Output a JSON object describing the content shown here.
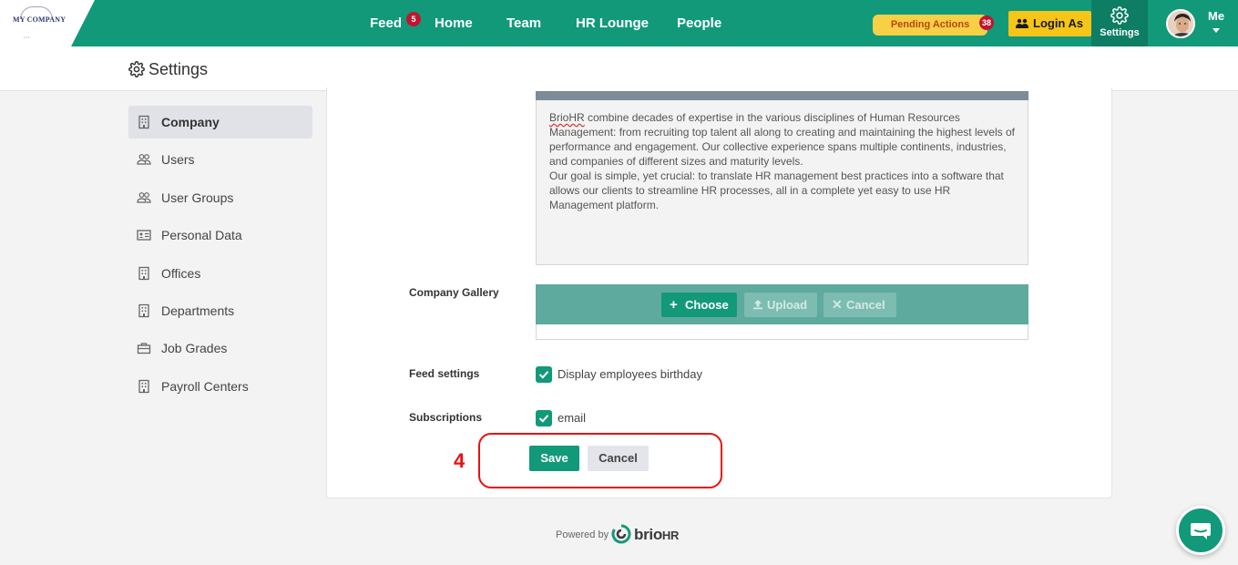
{
  "brand": {
    "logo_text": "MY COMPANY",
    "accent": "#12997a",
    "nav_dark": "#0d7d64"
  },
  "nav": {
    "items": [
      {
        "label": "Feed",
        "badge": "5"
      },
      {
        "label": "Home"
      },
      {
        "label": "Team"
      },
      {
        "label": "HR Lounge"
      },
      {
        "label": "People"
      }
    ],
    "pending_actions": {
      "label": "Pending Actions",
      "badge": "38"
    },
    "login_as": "Login As",
    "settings": "Settings",
    "me": "Me"
  },
  "header": {
    "title": "Settings",
    "icon": "gear-icon"
  },
  "sidebar": {
    "items": [
      {
        "label": "Company",
        "icon": "building-icon",
        "active": true
      },
      {
        "label": "Users",
        "icon": "users-icon"
      },
      {
        "label": "User Groups",
        "icon": "users-icon"
      },
      {
        "label": "Personal Data",
        "icon": "id-card-icon"
      },
      {
        "label": "Offices",
        "icon": "building-icon"
      },
      {
        "label": "Departments",
        "icon": "building-icon"
      },
      {
        "label": "Job Grades",
        "icon": "briefcase-icon"
      },
      {
        "label": "Payroll Centers",
        "icon": "building-icon"
      }
    ]
  },
  "description": {
    "brand_word": "BrioHR",
    "para1_rest": " combine decades of expertise in the various disciplines of Human Resources Management: from recruiting top talent all along to creating and maintaining the highest levels of performance and engagement. Our collective experience spans multiple continents, industries, and companies of different sizes and maturity levels.",
    "para2": "Our goal is simple, yet crucial: to translate HR management best practices into a software that allows our clients to streamline HR processes, all in a complete yet easy to use HR Management platform."
  },
  "gallery": {
    "label": "Company Gallery",
    "choose": "Choose",
    "upload": "Upload",
    "cancel": "Cancel"
  },
  "feed_settings": {
    "label": "Feed settings",
    "option": "Display employees birthday",
    "checked": true
  },
  "subscriptions": {
    "label": "Subscriptions",
    "option": "email",
    "checked": true
  },
  "actions": {
    "step": "4",
    "save": "Save",
    "cancel": "Cancel"
  },
  "footer": {
    "powered_by": "Powered by",
    "brand_main": "brio",
    "brand_suffix": "HR"
  }
}
